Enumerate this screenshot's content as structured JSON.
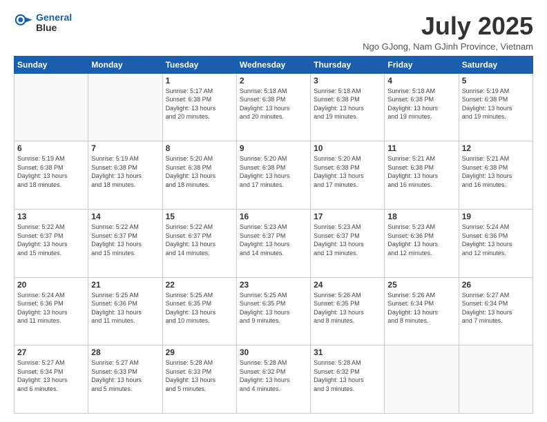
{
  "header": {
    "logo_line1": "General",
    "logo_line2": "Blue",
    "title": "July 2025",
    "subtitle": "Ngo GJong, Nam GJinh Province, Vietnam"
  },
  "weekdays": [
    "Sunday",
    "Monday",
    "Tuesday",
    "Wednesday",
    "Thursday",
    "Friday",
    "Saturday"
  ],
  "weeks": [
    [
      {
        "num": "",
        "info": ""
      },
      {
        "num": "",
        "info": ""
      },
      {
        "num": "1",
        "info": "Sunrise: 5:17 AM\nSunset: 6:38 PM\nDaylight: 13 hours\nand 20 minutes."
      },
      {
        "num": "2",
        "info": "Sunrise: 5:18 AM\nSunset: 6:38 PM\nDaylight: 13 hours\nand 20 minutes."
      },
      {
        "num": "3",
        "info": "Sunrise: 5:18 AM\nSunset: 6:38 PM\nDaylight: 13 hours\nand 19 minutes."
      },
      {
        "num": "4",
        "info": "Sunrise: 5:18 AM\nSunset: 6:38 PM\nDaylight: 13 hours\nand 19 minutes."
      },
      {
        "num": "5",
        "info": "Sunrise: 5:19 AM\nSunset: 6:38 PM\nDaylight: 13 hours\nand 19 minutes."
      }
    ],
    [
      {
        "num": "6",
        "info": "Sunrise: 5:19 AM\nSunset: 6:38 PM\nDaylight: 13 hours\nand 18 minutes."
      },
      {
        "num": "7",
        "info": "Sunrise: 5:19 AM\nSunset: 6:38 PM\nDaylight: 13 hours\nand 18 minutes."
      },
      {
        "num": "8",
        "info": "Sunrise: 5:20 AM\nSunset: 6:38 PM\nDaylight: 13 hours\nand 18 minutes."
      },
      {
        "num": "9",
        "info": "Sunrise: 5:20 AM\nSunset: 6:38 PM\nDaylight: 13 hours\nand 17 minutes."
      },
      {
        "num": "10",
        "info": "Sunrise: 5:20 AM\nSunset: 6:38 PM\nDaylight: 13 hours\nand 17 minutes."
      },
      {
        "num": "11",
        "info": "Sunrise: 5:21 AM\nSunset: 6:38 PM\nDaylight: 13 hours\nand 16 minutes."
      },
      {
        "num": "12",
        "info": "Sunrise: 5:21 AM\nSunset: 6:38 PM\nDaylight: 13 hours\nand 16 minutes."
      }
    ],
    [
      {
        "num": "13",
        "info": "Sunrise: 5:22 AM\nSunset: 6:37 PM\nDaylight: 13 hours\nand 15 minutes."
      },
      {
        "num": "14",
        "info": "Sunrise: 5:22 AM\nSunset: 6:37 PM\nDaylight: 13 hours\nand 15 minutes."
      },
      {
        "num": "15",
        "info": "Sunrise: 5:22 AM\nSunset: 6:37 PM\nDaylight: 13 hours\nand 14 minutes."
      },
      {
        "num": "16",
        "info": "Sunrise: 5:23 AM\nSunset: 6:37 PM\nDaylight: 13 hours\nand 14 minutes."
      },
      {
        "num": "17",
        "info": "Sunrise: 5:23 AM\nSunset: 6:37 PM\nDaylight: 13 hours\nand 13 minutes."
      },
      {
        "num": "18",
        "info": "Sunrise: 5:23 AM\nSunset: 6:36 PM\nDaylight: 13 hours\nand 12 minutes."
      },
      {
        "num": "19",
        "info": "Sunrise: 5:24 AM\nSunset: 6:36 PM\nDaylight: 13 hours\nand 12 minutes."
      }
    ],
    [
      {
        "num": "20",
        "info": "Sunrise: 5:24 AM\nSunset: 6:36 PM\nDaylight: 13 hours\nand 11 minutes."
      },
      {
        "num": "21",
        "info": "Sunrise: 5:25 AM\nSunset: 6:36 PM\nDaylight: 13 hours\nand 11 minutes."
      },
      {
        "num": "22",
        "info": "Sunrise: 5:25 AM\nSunset: 6:35 PM\nDaylight: 13 hours\nand 10 minutes."
      },
      {
        "num": "23",
        "info": "Sunrise: 5:25 AM\nSunset: 6:35 PM\nDaylight: 13 hours\nand 9 minutes."
      },
      {
        "num": "24",
        "info": "Sunrise: 5:26 AM\nSunset: 6:35 PM\nDaylight: 13 hours\nand 8 minutes."
      },
      {
        "num": "25",
        "info": "Sunrise: 5:26 AM\nSunset: 6:34 PM\nDaylight: 13 hours\nand 8 minutes."
      },
      {
        "num": "26",
        "info": "Sunrise: 5:27 AM\nSunset: 6:34 PM\nDaylight: 13 hours\nand 7 minutes."
      }
    ],
    [
      {
        "num": "27",
        "info": "Sunrise: 5:27 AM\nSunset: 6:34 PM\nDaylight: 13 hours\nand 6 minutes."
      },
      {
        "num": "28",
        "info": "Sunrise: 5:27 AM\nSunset: 6:33 PM\nDaylight: 13 hours\nand 5 minutes."
      },
      {
        "num": "29",
        "info": "Sunrise: 5:28 AM\nSunset: 6:33 PM\nDaylight: 13 hours\nand 5 minutes."
      },
      {
        "num": "30",
        "info": "Sunrise: 5:28 AM\nSunset: 6:32 PM\nDaylight: 13 hours\nand 4 minutes."
      },
      {
        "num": "31",
        "info": "Sunrise: 5:28 AM\nSunset: 6:32 PM\nDaylight: 13 hours\nand 3 minutes."
      },
      {
        "num": "",
        "info": ""
      },
      {
        "num": "",
        "info": ""
      }
    ]
  ]
}
